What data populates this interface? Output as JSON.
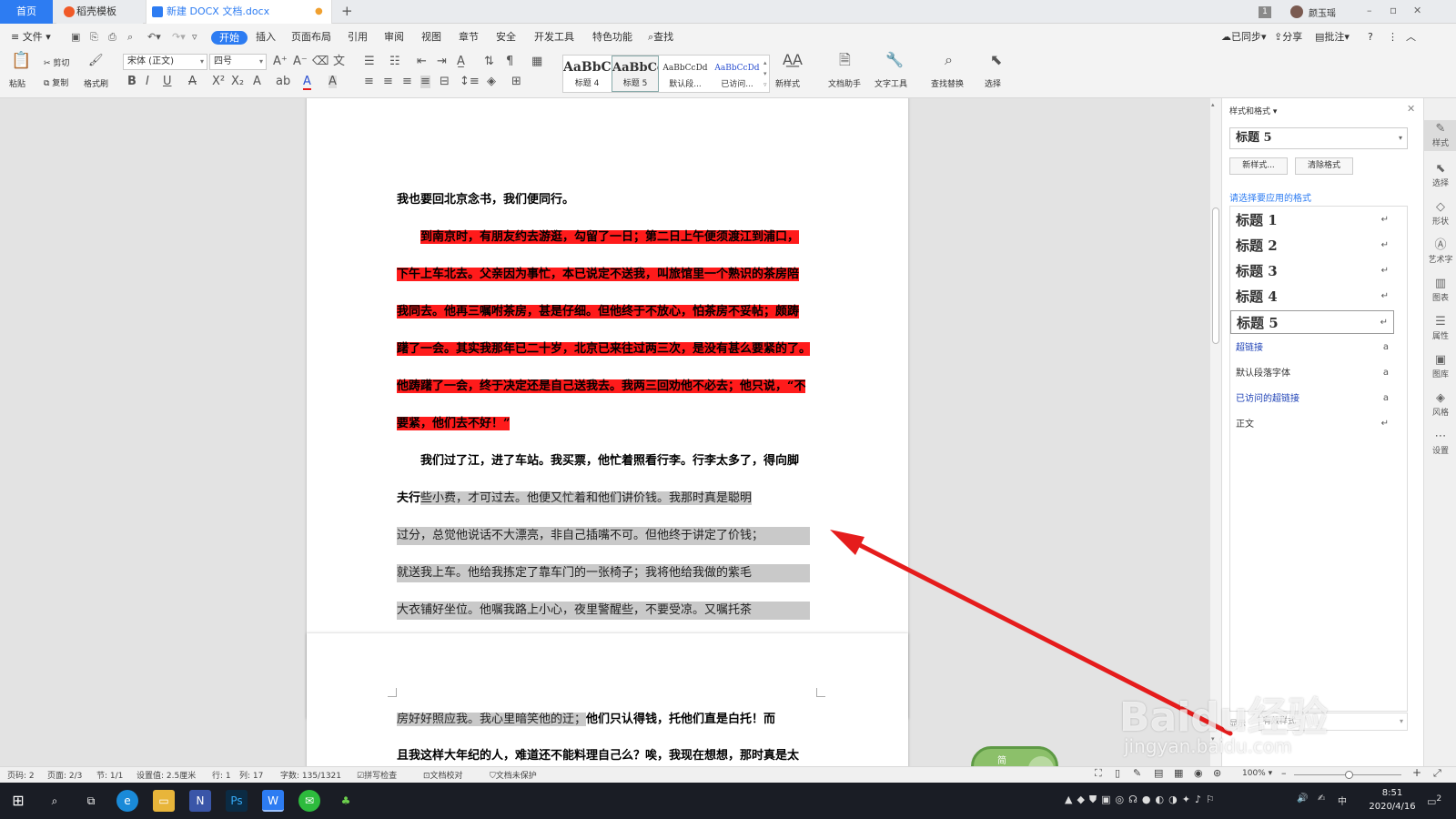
{
  "tabs": {
    "home": "首页",
    "templates": "稻壳模板",
    "document": "新建 DOCX 文档.docx",
    "new_tab": "+"
  },
  "titlebar": {
    "badge": "1",
    "user": "颜玉瑶",
    "minimize": "–",
    "restore": "▫",
    "close": "✕"
  },
  "menu": {
    "file": "文件",
    "items": [
      "开始",
      "插入",
      "页面布局",
      "引用",
      "审阅",
      "视图",
      "章节",
      "安全",
      "开发工具",
      "特色功能"
    ],
    "search": "查找",
    "synced": "已同步",
    "share": "分享",
    "comment": "批注",
    "help": "?"
  },
  "ribbon": {
    "paste": "粘贴",
    "cut": "剪切",
    "copy": "复制",
    "format_painter": "格式刷",
    "font_name": "宋体 (正文)",
    "font_size": "四号",
    "styles": [
      {
        "preview": "AaBbC",
        "label": "标题 4"
      },
      {
        "preview": "AaBbCc",
        "label": "标题 5"
      },
      {
        "preview": "AaBbCcDd",
        "label": "默认段..."
      },
      {
        "preview": "AaBbCcDd",
        "label": "已访问..."
      }
    ],
    "new_style": "新样式",
    "doc_helper": "文档助手",
    "text_tools": "文字工具",
    "find_replace": "查找替换",
    "select": "选择"
  },
  "document": {
    "page1_lines": [
      {
        "text": "我也要回北京念书，我们便同行。",
        "hl": "none",
        "indent": false
      },
      {
        "text": "到南京时，有朋友约去游逛，勾留了一日；第二日上午便须渡江到浦口，",
        "hl": "red",
        "indent": true
      },
      {
        "text": "下午上车北去。父亲因为事忙，本已说定不送我，叫旅馆里一个熟识的茶房陪",
        "hl": "red",
        "indent": false
      },
      {
        "text": "我同去。他再三嘱咐茶房，甚是仔细。但他终于不放心，怕茶房不妥帖；颇踌",
        "hl": "red",
        "indent": false
      },
      {
        "text": "躇了一会。其实我那年已二十岁，北京已来往过两三次，是没有甚么要紧的了。",
        "hl": "red",
        "indent": false
      },
      {
        "text": "他踌躇了一会，终于决定还是自己送我去。我两三回劝他不必去；他只说，“不",
        "hl": "red",
        "indent": false
      },
      {
        "text": "要紧，他们去不好！”",
        "hl": "red",
        "indent": false
      },
      {
        "text": "我们过了江，进了车站。我买票，他忙着照看行李。行李太多了，得向脚",
        "hl": "none",
        "indent": true
      },
      {
        "text": "夫行些小费，才可过去。他便又忙着和他们讲价钱。我那时真是聪明",
        "hl": "gray",
        "indent": false
      },
      {
        "text": "过分，总觉他说话不大漂亮，非自己插嘴不可。但他终于讲定了价钱；",
        "hl": "gray",
        "indent": false
      },
      {
        "text": "就送我上车。他给我拣定了靠车门的一张椅子；我将他给我做的紫毛",
        "hl": "gray",
        "indent": false
      },
      {
        "text": "大衣铺好坐位。他嘱我路上小心，夜里警醒些，不要受凉。又嘱托茶",
        "hl": "gray",
        "indent": false
      }
    ],
    "page2_line1_gray": "房好好照应我。我心里暗笑他的迂；",
    "page2_line1_rest": "他们只认得钱，托他们直是白托！而",
    "page2_line2": "且我这样大年纪的人，难道还不能料理自己么？唉，我现在想想，那时真是太"
  },
  "panel": {
    "title": "样式和格式",
    "current_style": "标题 5",
    "new_style_btn": "新样式...",
    "clear_btn": "清除格式",
    "prompt": "请选择要应用的格式",
    "styles": [
      {
        "name": "标题  1",
        "kind": "heading"
      },
      {
        "name": "标题  2",
        "kind": "heading"
      },
      {
        "name": "标题  3",
        "kind": "heading"
      },
      {
        "name": "标题  4",
        "kind": "heading"
      },
      {
        "name": "标题  5",
        "kind": "heading"
      },
      {
        "name": "超链接",
        "kind": "link"
      },
      {
        "name": "默认段落字体",
        "kind": "plain"
      },
      {
        "name": "已访问的超链接",
        "kind": "link"
      },
      {
        "name": "正文",
        "kind": "plain"
      }
    ],
    "show_label": "显示",
    "show_value": "有效样式"
  },
  "sidestrip": [
    "样式",
    "选择",
    "形状",
    "艺术字",
    "图表",
    "属性",
    "图库",
    "风格",
    "设置"
  ],
  "status": {
    "page_no": "页码: 2",
    "pages": "页面: 2/3",
    "section": "节: 1/1",
    "setting": "设置值: 2.5厘米",
    "row": "行: 1",
    "col": "列: 17",
    "words": "字数: 135/1321",
    "spell": "拼写检查",
    "proof": "文档校对",
    "protect": "文档未保护",
    "zoom": "100%"
  },
  "ime": {
    "top": "简",
    "bottom": "中"
  },
  "taskbar": {
    "time": "8:51",
    "date": "2020/4/16",
    "ime": "中",
    "notifications": "2"
  },
  "watermark": "Baidu经验",
  "watermark_url": "jingyan.baidu.com",
  "colors": {
    "accent": "#2d7cf2",
    "red_highlight": "#ff1b1b",
    "gray_highlight": "#c9c9c9",
    "arrow": "#e51c1c"
  }
}
